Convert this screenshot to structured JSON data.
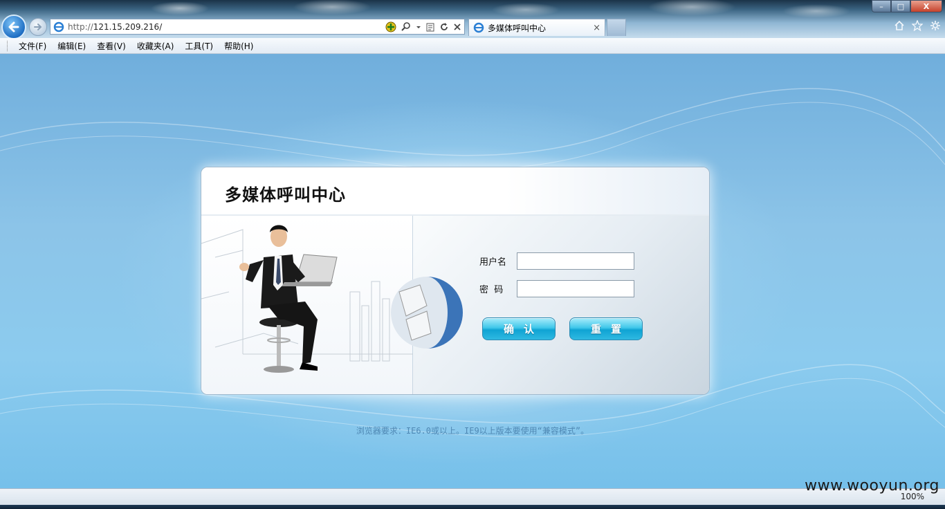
{
  "browser": {
    "address_proto": "http://",
    "address_host": "121.15.209.216/",
    "tab_title": "多媒体呼叫中心",
    "close_glyph": "×",
    "window_min": "–",
    "window_max": "□",
    "window_close": "X"
  },
  "menu": [
    {
      "label": "文件(F)"
    },
    {
      "label": "编辑(E)"
    },
    {
      "label": "查看(V)"
    },
    {
      "label": "收藏夹(A)"
    },
    {
      "label": "工具(T)"
    },
    {
      "label": "帮助(H)"
    }
  ],
  "login": {
    "title": "多媒体呼叫中心",
    "username_label": "用户名",
    "password_label": "密  码",
    "username_value": "",
    "password_value": "",
    "confirm_label": "确认",
    "reset_label": "重置"
  },
  "footer": {
    "requirement": "浏览器要求：IE6.0或以上。IE9以上版本要使用“兼容模式”。"
  },
  "status": {
    "zoom": "100%",
    "watermark": "www.wooyun.org"
  },
  "colors": {
    "accent_button": "#2fb9e2",
    "page_bg": "#8cc4e8"
  }
}
